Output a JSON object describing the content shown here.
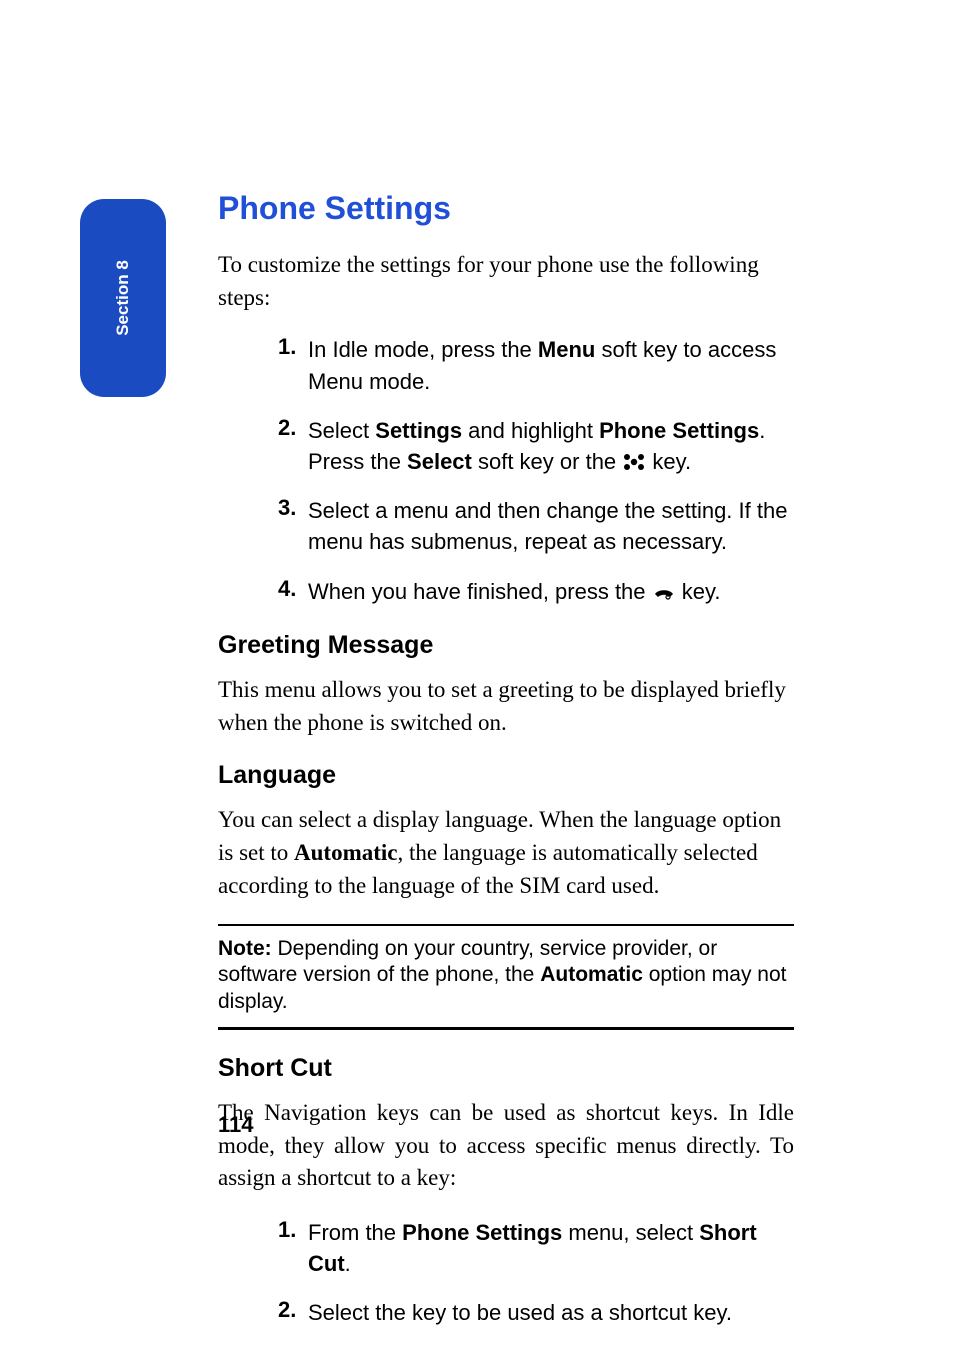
{
  "section_tab": "Section 8",
  "title": "Phone Settings",
  "intro": "To customize the settings for your phone use the following steps:",
  "steps": {
    "s1_a": "In Idle mode, press the ",
    "s1_b": "Menu",
    "s1_c": " soft key to access Menu mode.",
    "s2_a": "Select ",
    "s2_b": "Settings",
    "s2_c": " and highlight ",
    "s2_d": "Phone Settings",
    "s2_e": ". Press the ",
    "s2_f": "Select",
    "s2_g": " soft key or the ",
    "s2_h": " key.",
    "s3": "Select a menu and then change the setting. If the menu has submenus, repeat as necessary.",
    "s4_a": "When you have finished, press the ",
    "s4_b": " key."
  },
  "greeting": {
    "heading": "Greeting Message",
    "body": "This menu allows you to set a greeting to be displayed briefly when the phone is switched on."
  },
  "language": {
    "heading": "Language",
    "body_a": "You can select a display language. When the language option is set to ",
    "body_b": "Automatic",
    "body_c": ", the language is automatically selected according to the language of the SIM card used."
  },
  "note": {
    "label": "Note:",
    "text_a": " Depending on your country, service provider, or software version of the phone, the ",
    "text_b": "Automatic",
    "text_c": " option may not display."
  },
  "shortcut": {
    "heading": "Short Cut",
    "body": "The Navigation keys can be used as shortcut keys. In Idle mode, they allow you to access specific menus directly. To assign a shortcut to a key:",
    "s1_a": "From the ",
    "s1_b": "Phone Settings",
    "s1_c": " menu, select ",
    "s1_d": "Short Cut",
    "s1_e": ".",
    "s2": "Select the key to be used as a shortcut key."
  },
  "page_number": "114"
}
